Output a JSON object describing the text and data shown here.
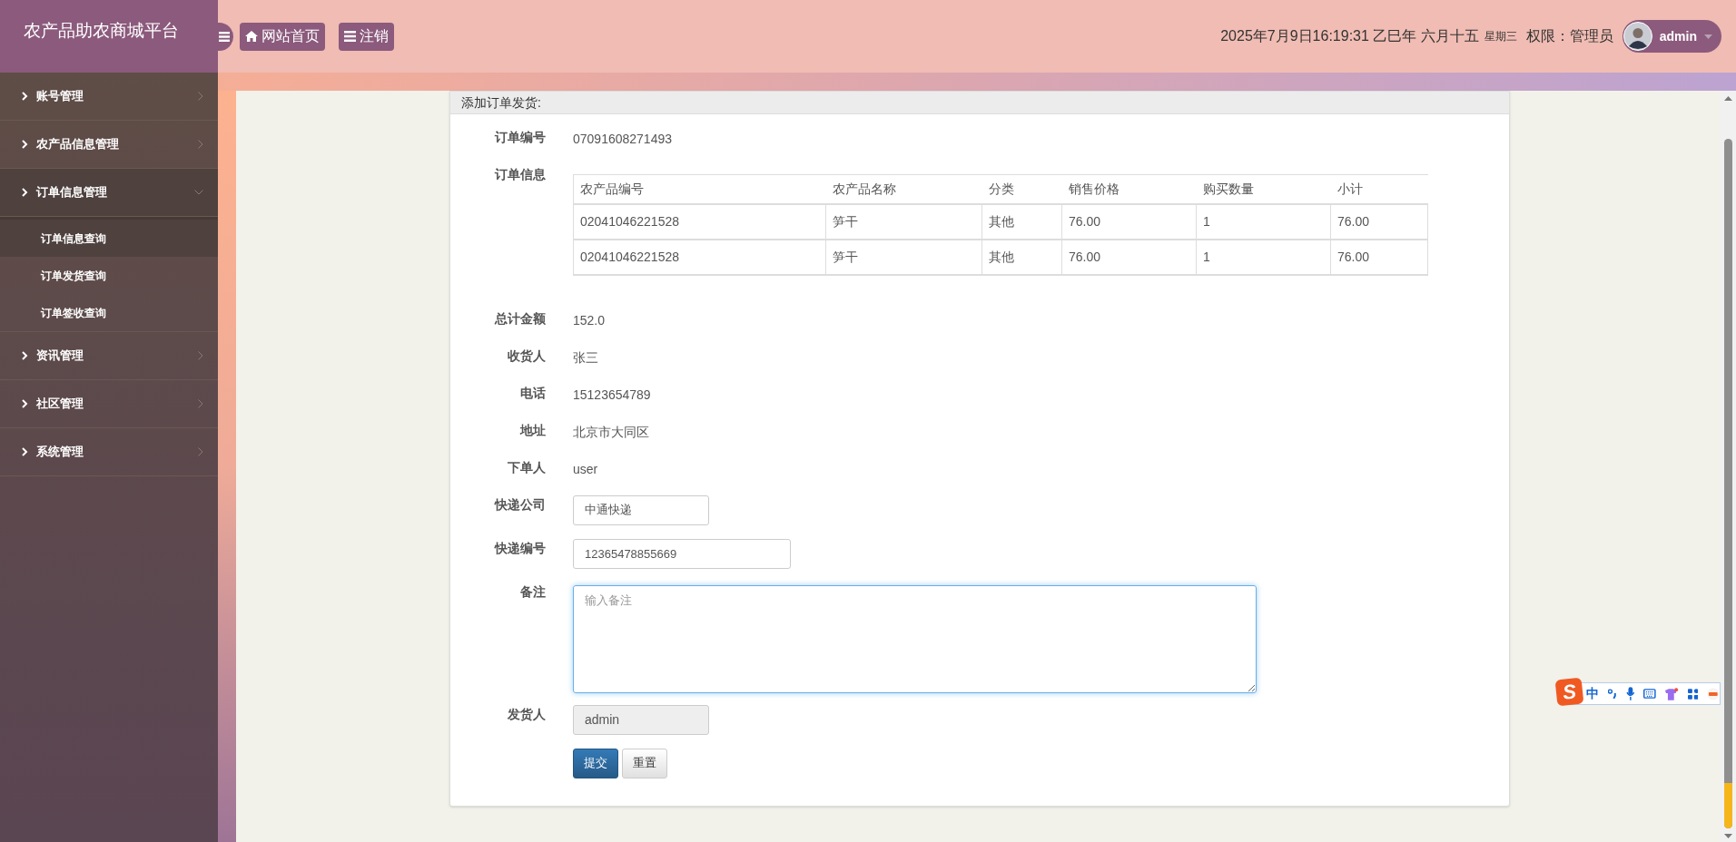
{
  "sidebar": {
    "brand": "农产品助农商城平台",
    "items": [
      {
        "label": "账号管理",
        "expanded": false
      },
      {
        "label": "农产品信息管理",
        "expanded": false
      },
      {
        "label": "订单信息管理",
        "expanded": true,
        "children": [
          {
            "label": "订单信息查询",
            "selected": true
          },
          {
            "label": "订单发货查询",
            "selected": false
          },
          {
            "label": "订单签收查询",
            "selected": false
          }
        ]
      },
      {
        "label": "资讯管理",
        "expanded": false
      },
      {
        "label": "社区管理",
        "expanded": false
      },
      {
        "label": "系统管理",
        "expanded": false
      }
    ]
  },
  "header": {
    "buttons": [
      {
        "label": "网站首页",
        "kind": "home"
      },
      {
        "label": "注销",
        "kind": "menu"
      }
    ],
    "datetime": "2025年7月9日16:19:31 乙巳年 六月十五",
    "weekday": "星期三",
    "role": "权限：管理员",
    "user": "admin"
  },
  "panel": {
    "title": "添加订单发货:",
    "fields": [
      {
        "kind": "text",
        "label": "订单编号",
        "value": "07091608271493"
      },
      {
        "kind": "table",
        "label": "订单信息",
        "columns": [
          "农产品编号",
          "农产品名称",
          "分类",
          "销售价格",
          "购买数量",
          "小计"
        ],
        "rows": [
          [
            "02041046221528",
            "笋干",
            "其他",
            "76.00",
            "1",
            "76.00"
          ],
          [
            "02041046221528",
            "笋干",
            "其他",
            "76.00",
            "1",
            "76.00"
          ]
        ]
      },
      {
        "kind": "text",
        "label": "总计金额",
        "value": "152.0"
      },
      {
        "kind": "text",
        "label": "收货人",
        "value": "张三"
      },
      {
        "kind": "text",
        "label": "电话",
        "value": "15123654789"
      },
      {
        "kind": "text",
        "label": "地址",
        "value": "北京市大同区"
      },
      {
        "kind": "text",
        "label": "下单人",
        "value": "user"
      },
      {
        "kind": "input",
        "label": "快递公司",
        "value": "中通快递",
        "wide": false
      },
      {
        "kind": "input",
        "label": "快递编号",
        "value": "12365478855669",
        "wide": true
      },
      {
        "kind": "textarea",
        "label": "备注",
        "placeholder": "输入备注",
        "focused": true
      },
      {
        "kind": "readonly",
        "label": "发货人",
        "value": "admin",
        "disabled": true
      },
      {
        "kind": "actions",
        "buttons": [
          {
            "label": "提交",
            "kind": "primary"
          },
          {
            "label": "重置",
            "kind": "default"
          }
        ]
      }
    ]
  },
  "ime_toolbar": {
    "logo": "S",
    "mode": "中"
  }
}
